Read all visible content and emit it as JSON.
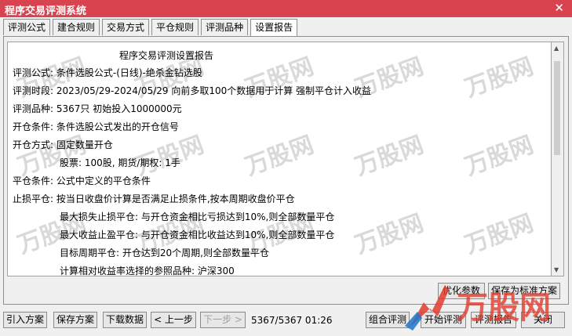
{
  "window": {
    "title": "程序交易评测系统",
    "close_glyph": "✕"
  },
  "tabs": [
    "评测公式",
    "建合规则",
    "交易方式",
    "平仓规则",
    "评测品种",
    "设置报告"
  ],
  "active_tab_index": 5,
  "report": {
    "heading": "程序交易评测设置报告",
    "lines": [
      "评测公式: 条件选股公式-(日线)-绝杀金钻选股",
      "评测时段: 2023/05/29-2024/05/29 向前多取100个数据用于计算 强制平仓计入收益",
      "评测品种: 5367只 初始投入1000000元",
      "开仓条件: 条件选股公式发出的开仓信号",
      "开仓方式: 固定数量开仓",
      "股票: 100股, 期货/期权: 1手",
      "平仓条件: 公式中定义的平仓条件",
      "止损平仓: 按当日收盘价计算是否满足止损条件,按本周期收盘价平仓",
      "最大损失止损平仓: 与开仓资金相比亏损达到10%,则全部数量平仓",
      "最大收益止盈平仓: 与开仓资金相比收益达到10%,则全部数量平仓",
      "目标周期平仓: 开仓达到20个周期,则全部数量平仓",
      "计算相对收益率选择的参照品种: 沪深300"
    ]
  },
  "panel_buttons": {
    "optimize": "优化参数",
    "save_scheme": "保存为标准方案"
  },
  "bottom_buttons": {
    "import": "引入方案",
    "save": "保存方案",
    "download": "下载数据",
    "prev": "< 上一步",
    "next": "下一步 >",
    "combo": "组合评测",
    "start": "开始评测",
    "report": "评测报告",
    "close": "关闭"
  },
  "status": "5367/5367 01:26",
  "watermark": {
    "text": "万股网",
    "color": "#d9d9d9",
    "logo_primary": "#e23b2e",
    "logo_accent": "#1f76c9"
  }
}
